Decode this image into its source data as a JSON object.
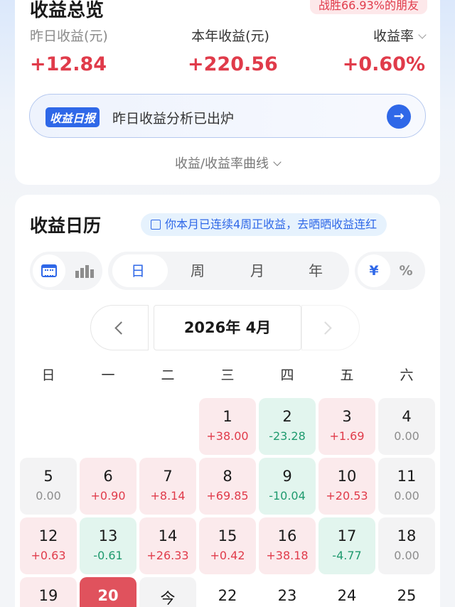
{
  "overview": {
    "title": "收益总览",
    "badge": "战胜66.93%的朋友",
    "metrics": [
      {
        "label": "昨日收益(元)",
        "value": "+12.84"
      },
      {
        "label": "本年收益(元)",
        "value": "+220.56"
      },
      {
        "label": "收益率",
        "value": "+0.60%"
      }
    ],
    "banner_tag": "收益日报",
    "banner_text": "昨日收益分析已出炉",
    "curve_label": "收益/收益率曲线"
  },
  "calendar": {
    "title": "收益日历",
    "tip": "你本月已连续4周正收益，去晒晒收益连红",
    "period_tabs": [
      "日",
      "周",
      "月",
      "年"
    ],
    "selected_period": "日",
    "units": [
      "¥",
      "%"
    ],
    "selected_unit": "¥",
    "month_label": "2026年 4月",
    "weekdays": [
      "日",
      "一",
      "二",
      "三",
      "四",
      "五",
      "六"
    ],
    "days": [
      {
        "d": "1",
        "v": "+38.00",
        "t": "up"
      },
      {
        "d": "2",
        "v": "-23.28",
        "t": "down"
      },
      {
        "d": "3",
        "v": "+1.69",
        "t": "up"
      },
      {
        "d": "4",
        "v": "0.00",
        "t": "zero"
      },
      {
        "d": "5",
        "v": "0.00",
        "t": "zero"
      },
      {
        "d": "6",
        "v": "+0.90",
        "t": "up"
      },
      {
        "d": "7",
        "v": "+8.14",
        "t": "up"
      },
      {
        "d": "8",
        "v": "+69.85",
        "t": "up"
      },
      {
        "d": "9",
        "v": "-10.04",
        "t": "down"
      },
      {
        "d": "10",
        "v": "+20.53",
        "t": "up"
      },
      {
        "d": "11",
        "v": "0.00",
        "t": "zero"
      },
      {
        "d": "12",
        "v": "+0.63",
        "t": "up"
      },
      {
        "d": "13",
        "v": "-0.61",
        "t": "down"
      },
      {
        "d": "14",
        "v": "+26.33",
        "t": "up"
      },
      {
        "d": "15",
        "v": "+0.42",
        "t": "up"
      },
      {
        "d": "16",
        "v": "+38.18",
        "t": "up"
      },
      {
        "d": "17",
        "v": "-4.77",
        "t": "down"
      },
      {
        "d": "18",
        "v": "0.00",
        "t": "zero"
      },
      {
        "d": "19",
        "v": "",
        "t": "up"
      },
      {
        "d": "20",
        "v": "",
        "t": "sel"
      },
      {
        "d": "今",
        "v": "",
        "t": "today"
      },
      {
        "d": "22",
        "v": "",
        "t": "none"
      },
      {
        "d": "23",
        "v": "",
        "t": "none"
      },
      {
        "d": "24",
        "v": "",
        "t": "none"
      },
      {
        "d": "25",
        "v": "",
        "t": "none"
      }
    ],
    "first_weekday": 3
  },
  "colors": {
    "up": "#e03b4a",
    "down": "#1f9a6e",
    "accent": "#2f68e8"
  }
}
